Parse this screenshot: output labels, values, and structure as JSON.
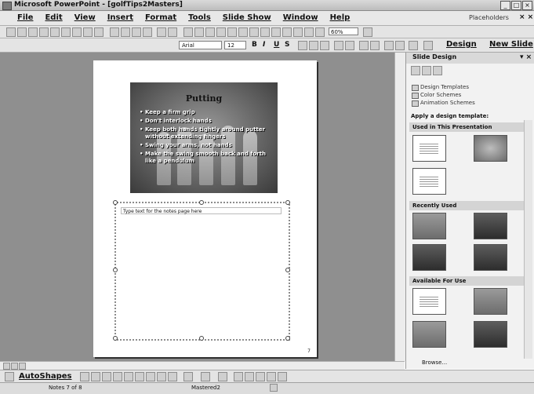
{
  "window": {
    "title": "Microsoft PowerPoint - [golfTips2Masters]",
    "buttons": [
      "_",
      "□",
      "×"
    ]
  },
  "menubar": {
    "items": [
      "File",
      "Edit",
      "View",
      "Insert",
      "Format",
      "Tools",
      "Slide Show",
      "Window",
      "Help"
    ],
    "help_search": "Placeholders",
    "close_doc": "× ×"
  },
  "toolbar": {
    "zoom": "60%",
    "font": "Arial",
    "font_size": "12",
    "bold": "B",
    "italic": "I",
    "underline": "U",
    "shadow": "S",
    "design_label": "Design",
    "new_slide_label": "New Slide"
  },
  "slide": {
    "title": "Putting",
    "bullets": [
      "Keep a firm grip",
      "Don't interlock hands",
      "Keep both hands tightly around putter without extending fingers",
      "Swing your arms, not hands",
      "Make the swing smooth back and forth like a pendulum"
    ]
  },
  "notes": {
    "placeholder": "Type text for the notes page here",
    "page_number": "7"
  },
  "taskpane": {
    "title": "Slide Design",
    "links": [
      "Design Templates",
      "Color Schemes",
      "Animation Schemes"
    ],
    "apply_label": "Apply a design template:",
    "sections": [
      "Used in This Presentation",
      "Recently Used",
      "Available For Use"
    ],
    "browse": "Browse..."
  },
  "drawing": {
    "autoshapes": "AutoShapes"
  },
  "status": {
    "notes": "Notes 7 of 8",
    "design": "Mastered2"
  }
}
